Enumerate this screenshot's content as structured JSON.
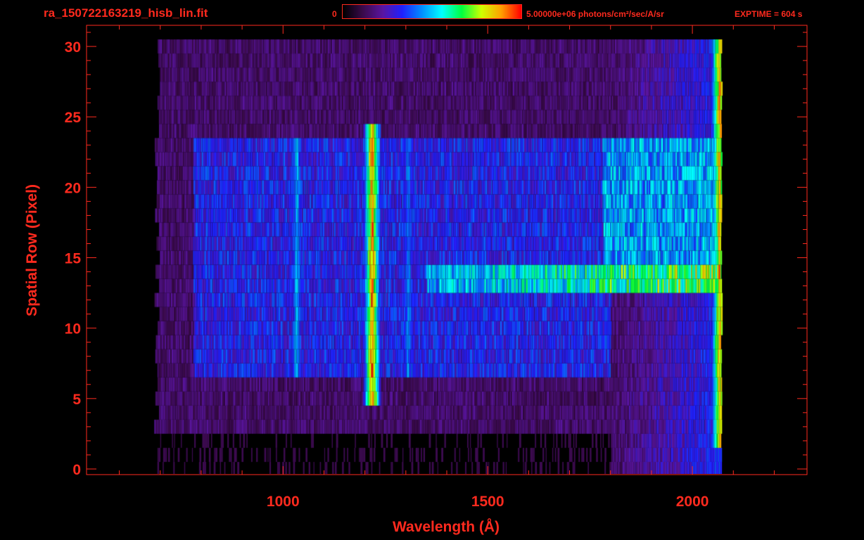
{
  "header": {
    "file_name": "ra_150722163219_hisb_lin.fit",
    "colorbar_min": "0",
    "colorbar_max": "5.00000e+06 photons/cm²/sec/A/sr",
    "exptime": "EXPTIME = 604 s"
  },
  "colors": {
    "axis": "#ff2a1e",
    "background": "#000000",
    "colormap": [
      "#000000",
      "#3a0a4a",
      "#5a15a0",
      "#2020ff",
      "#0090ff",
      "#00ffff",
      "#00ff40",
      "#d0ff00",
      "#ffa000",
      "#ff0000"
    ]
  },
  "chart_data": {
    "type": "heatmap",
    "xlabel": "Wavelength (Å)",
    "ylabel": "Spatial Row (Pixel)",
    "xlim": [
      520,
      2280
    ],
    "ylim": [
      -0.4,
      31.5
    ],
    "x_ticks": [
      1000,
      1500,
      2000
    ],
    "y_ticks": [
      0,
      5,
      10,
      15,
      20,
      25,
      30
    ],
    "value_range": [
      0,
      5000000
    ],
    "value_unit": "photons/cm²/sec/A/sr",
    "rows": 31,
    "wavelength_start": 700,
    "wavelength_end": 2070,
    "bright_lines": [
      {
        "wavelength": 1216,
        "rows": [
          5,
          24
        ],
        "level": 0.95
      },
      {
        "wavelength": 1032,
        "rows": [
          7,
          23
        ],
        "level": 0.5
      },
      {
        "wavelength": 1304,
        "rows": [
          7,
          23
        ],
        "level": 0.45
      },
      {
        "wavelength": 2065,
        "rows": [
          2,
          30
        ],
        "level": 0.9
      }
    ],
    "bands": [
      {
        "rows": [
          13,
          14
        ],
        "wavelength_range": [
          1350,
          2060
        ],
        "level": 0.7
      },
      {
        "rows": [
          15,
          23
        ],
        "wavelength_range": [
          1780,
          2060
        ],
        "level": 0.5
      },
      {
        "rows": [
          7,
          23
        ],
        "wavelength_range": [
          780,
          1800
        ],
        "level": 0.35
      }
    ]
  }
}
